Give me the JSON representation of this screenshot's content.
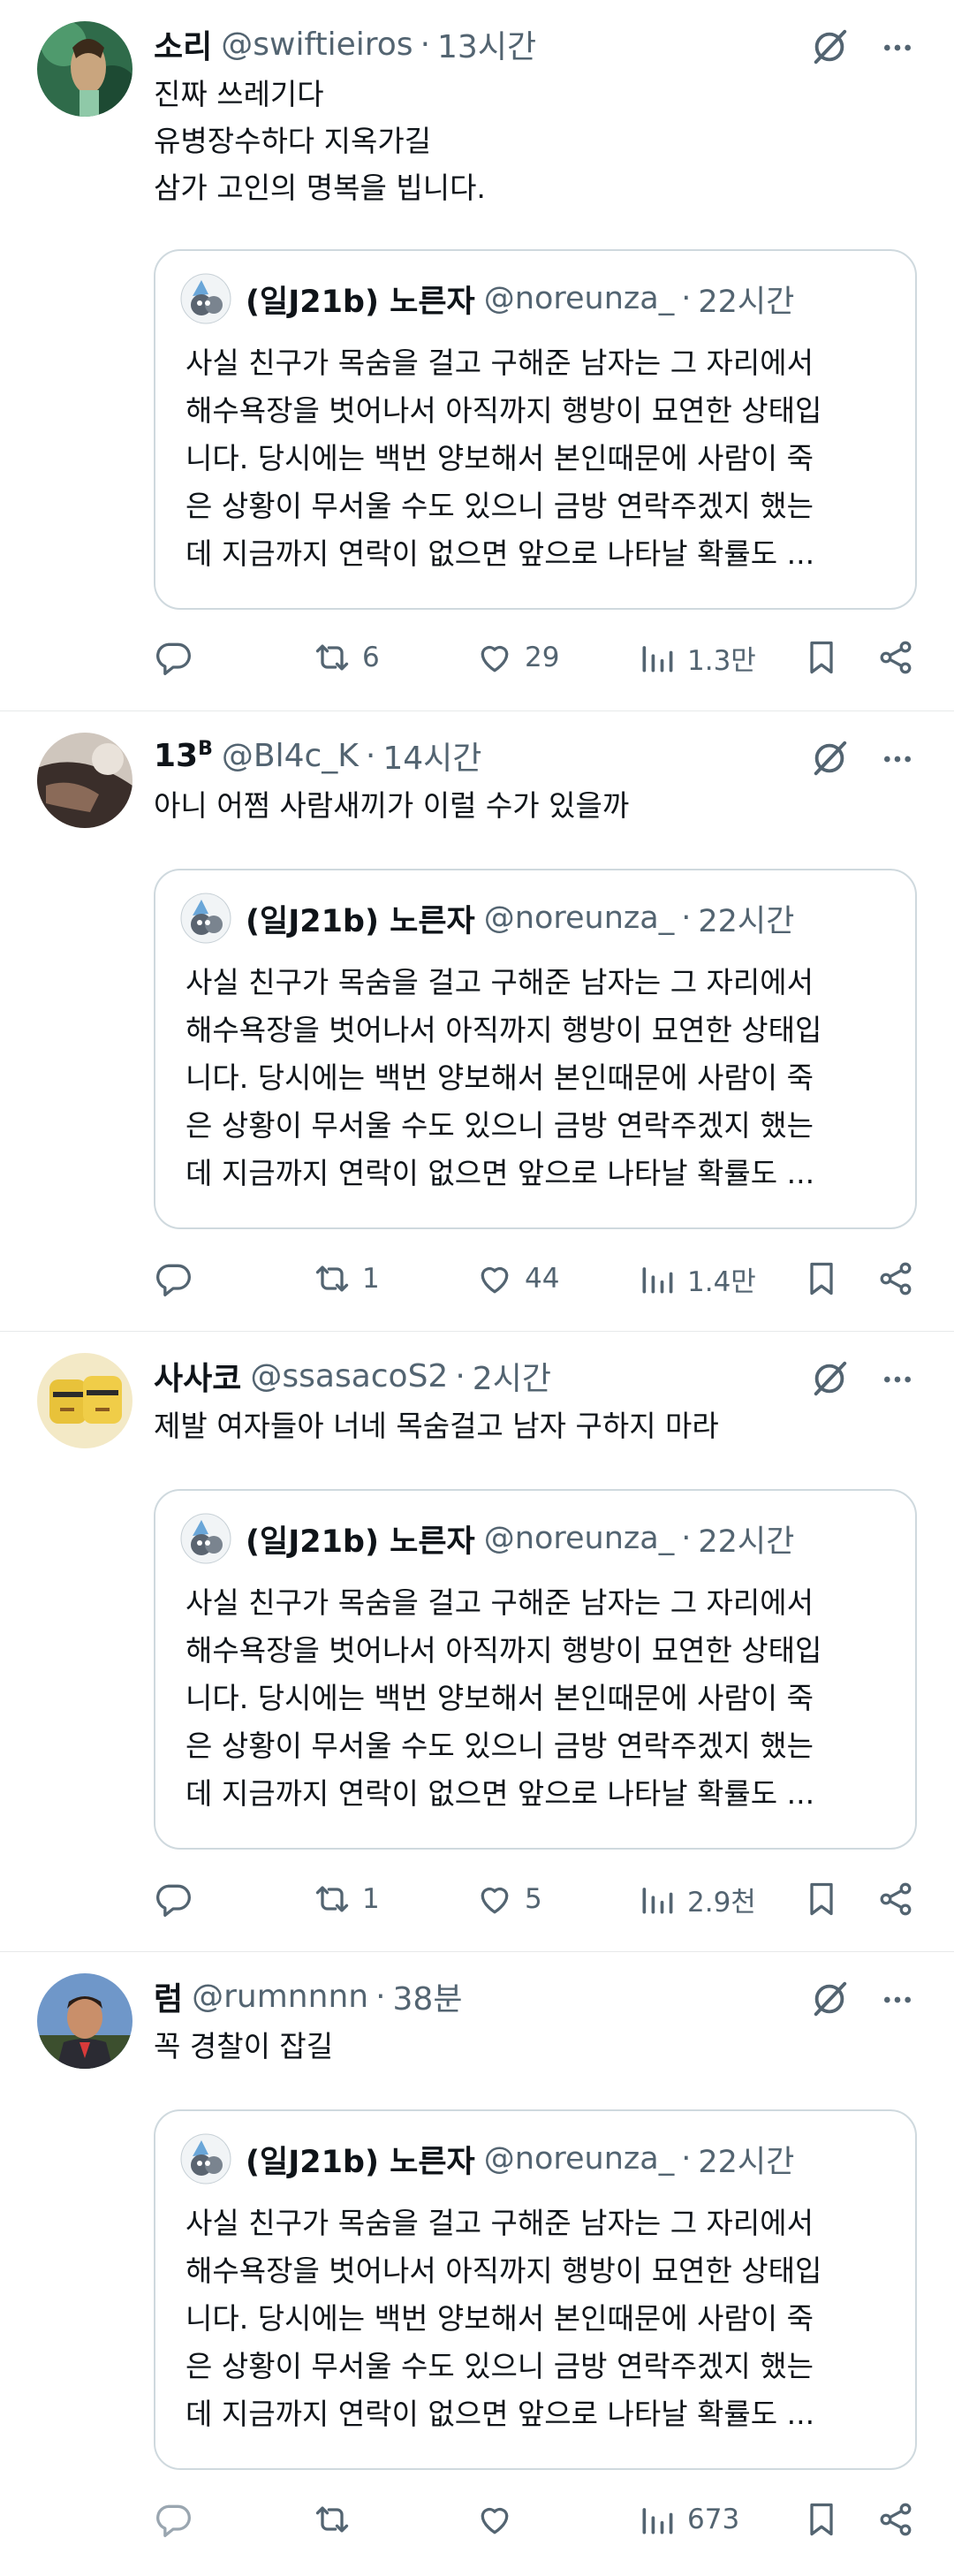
{
  "posts": [
    {
      "name": "소리",
      "name_sup": "",
      "handle": "@swiftieiros",
      "sep": "·",
      "time": "13시간",
      "text": [
        "진짜 쓰레기다",
        "유병장수하다 지옥가길",
        "삼가 고인의 명복을 빕니다."
      ],
      "counts": {
        "reply": "",
        "retweet": "6",
        "like": "29",
        "views": "1.3만"
      }
    },
    {
      "name": "13",
      "name_sup": "B",
      "handle": "@Bl4c_K",
      "sep": "·",
      "time": "14시간",
      "text": [
        "아니 어쩜 사람새끼가 이럴 수가 있을까"
      ],
      "counts": {
        "reply": "",
        "retweet": "1",
        "like": "44",
        "views": "1.4만"
      }
    },
    {
      "name": "사사코",
      "name_sup": "",
      "handle": "@ssasacoS2",
      "sep": "·",
      "time": "2시간",
      "text": [
        "제발 여자들아 너네 목숨걸고 남자 구하지 마라"
      ],
      "counts": {
        "reply": "",
        "retweet": "1",
        "like": "5",
        "views": "2.9천"
      }
    },
    {
      "name": "럼",
      "name_sup": "",
      "handle": "@rumnnnn",
      "sep": "·",
      "time": "38분",
      "text": [
        "꼭 경찰이 잡길"
      ],
      "counts": {
        "reply": "",
        "retweet": "",
        "like": "",
        "views": "673"
      }
    }
  ],
  "quote": {
    "name": "(일J21b) 노른자",
    "handle": "@noreunza_",
    "sep": "·",
    "time": "22시간",
    "lines": [
      "사실 친구가 목숨을 걸고 구해준 남자는 그 자리에서",
      "해수욕장을 벗어나서 아직까지 행방이 묘연한 상태입",
      "니다. 당시에는 백번 양보해서 본인때문에 사람이 죽",
      "은 상황이 무서울 수도 있으니 금방 연락주겠지 했는",
      "데 지금까지 연락이 없으면 앞으로 나타날 확률도 ..."
    ]
  },
  "colors": {
    "text": "#0f1419",
    "secondary": "#536471",
    "border": "#cfd9de",
    "divider": "#e7e9ea"
  },
  "icons": [
    "grok-icon",
    "more-icon",
    "reply-icon",
    "retweet-icon",
    "like-icon",
    "views-icon",
    "bookmark-icon",
    "share-icon"
  ]
}
